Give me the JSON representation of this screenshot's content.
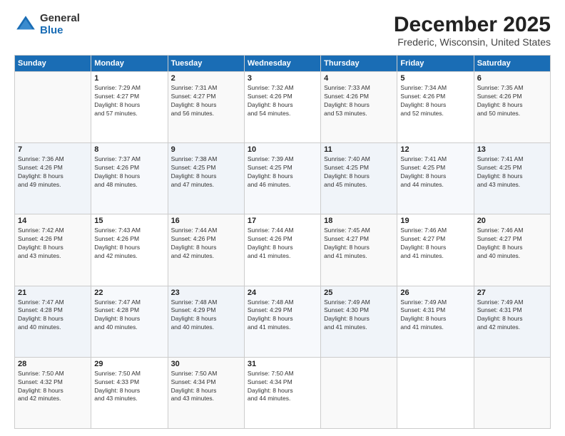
{
  "logo": {
    "general": "General",
    "blue": "Blue"
  },
  "title": "December 2025",
  "subtitle": "Frederic, Wisconsin, United States",
  "headers": [
    "Sunday",
    "Monday",
    "Tuesday",
    "Wednesday",
    "Thursday",
    "Friday",
    "Saturday"
  ],
  "weeks": [
    [
      {
        "day": "",
        "info": ""
      },
      {
        "day": "1",
        "info": "Sunrise: 7:29 AM\nSunset: 4:27 PM\nDaylight: 8 hours\nand 57 minutes."
      },
      {
        "day": "2",
        "info": "Sunrise: 7:31 AM\nSunset: 4:27 PM\nDaylight: 8 hours\nand 56 minutes."
      },
      {
        "day": "3",
        "info": "Sunrise: 7:32 AM\nSunset: 4:26 PM\nDaylight: 8 hours\nand 54 minutes."
      },
      {
        "day": "4",
        "info": "Sunrise: 7:33 AM\nSunset: 4:26 PM\nDaylight: 8 hours\nand 53 minutes."
      },
      {
        "day": "5",
        "info": "Sunrise: 7:34 AM\nSunset: 4:26 PM\nDaylight: 8 hours\nand 52 minutes."
      },
      {
        "day": "6",
        "info": "Sunrise: 7:35 AM\nSunset: 4:26 PM\nDaylight: 8 hours\nand 50 minutes."
      }
    ],
    [
      {
        "day": "7",
        "info": "Sunrise: 7:36 AM\nSunset: 4:26 PM\nDaylight: 8 hours\nand 49 minutes."
      },
      {
        "day": "8",
        "info": "Sunrise: 7:37 AM\nSunset: 4:26 PM\nDaylight: 8 hours\nand 48 minutes."
      },
      {
        "day": "9",
        "info": "Sunrise: 7:38 AM\nSunset: 4:25 PM\nDaylight: 8 hours\nand 47 minutes."
      },
      {
        "day": "10",
        "info": "Sunrise: 7:39 AM\nSunset: 4:25 PM\nDaylight: 8 hours\nand 46 minutes."
      },
      {
        "day": "11",
        "info": "Sunrise: 7:40 AM\nSunset: 4:25 PM\nDaylight: 8 hours\nand 45 minutes."
      },
      {
        "day": "12",
        "info": "Sunrise: 7:41 AM\nSunset: 4:25 PM\nDaylight: 8 hours\nand 44 minutes."
      },
      {
        "day": "13",
        "info": "Sunrise: 7:41 AM\nSunset: 4:25 PM\nDaylight: 8 hours\nand 43 minutes."
      }
    ],
    [
      {
        "day": "14",
        "info": "Sunrise: 7:42 AM\nSunset: 4:26 PM\nDaylight: 8 hours\nand 43 minutes."
      },
      {
        "day": "15",
        "info": "Sunrise: 7:43 AM\nSunset: 4:26 PM\nDaylight: 8 hours\nand 42 minutes."
      },
      {
        "day": "16",
        "info": "Sunrise: 7:44 AM\nSunset: 4:26 PM\nDaylight: 8 hours\nand 42 minutes."
      },
      {
        "day": "17",
        "info": "Sunrise: 7:44 AM\nSunset: 4:26 PM\nDaylight: 8 hours\nand 41 minutes."
      },
      {
        "day": "18",
        "info": "Sunrise: 7:45 AM\nSunset: 4:27 PM\nDaylight: 8 hours\nand 41 minutes."
      },
      {
        "day": "19",
        "info": "Sunrise: 7:46 AM\nSunset: 4:27 PM\nDaylight: 8 hours\nand 41 minutes."
      },
      {
        "day": "20",
        "info": "Sunrise: 7:46 AM\nSunset: 4:27 PM\nDaylight: 8 hours\nand 40 minutes."
      }
    ],
    [
      {
        "day": "21",
        "info": "Sunrise: 7:47 AM\nSunset: 4:28 PM\nDaylight: 8 hours\nand 40 minutes."
      },
      {
        "day": "22",
        "info": "Sunrise: 7:47 AM\nSunset: 4:28 PM\nDaylight: 8 hours\nand 40 minutes."
      },
      {
        "day": "23",
        "info": "Sunrise: 7:48 AM\nSunset: 4:29 PM\nDaylight: 8 hours\nand 40 minutes."
      },
      {
        "day": "24",
        "info": "Sunrise: 7:48 AM\nSunset: 4:29 PM\nDaylight: 8 hours\nand 41 minutes."
      },
      {
        "day": "25",
        "info": "Sunrise: 7:49 AM\nSunset: 4:30 PM\nDaylight: 8 hours\nand 41 minutes."
      },
      {
        "day": "26",
        "info": "Sunrise: 7:49 AM\nSunset: 4:31 PM\nDaylight: 8 hours\nand 41 minutes."
      },
      {
        "day": "27",
        "info": "Sunrise: 7:49 AM\nSunset: 4:31 PM\nDaylight: 8 hours\nand 42 minutes."
      }
    ],
    [
      {
        "day": "28",
        "info": "Sunrise: 7:50 AM\nSunset: 4:32 PM\nDaylight: 8 hours\nand 42 minutes."
      },
      {
        "day": "29",
        "info": "Sunrise: 7:50 AM\nSunset: 4:33 PM\nDaylight: 8 hours\nand 43 minutes."
      },
      {
        "day": "30",
        "info": "Sunrise: 7:50 AM\nSunset: 4:34 PM\nDaylight: 8 hours\nand 43 minutes."
      },
      {
        "day": "31",
        "info": "Sunrise: 7:50 AM\nSunset: 4:34 PM\nDaylight: 8 hours\nand 44 minutes."
      },
      {
        "day": "",
        "info": ""
      },
      {
        "day": "",
        "info": ""
      },
      {
        "day": "",
        "info": ""
      }
    ]
  ]
}
